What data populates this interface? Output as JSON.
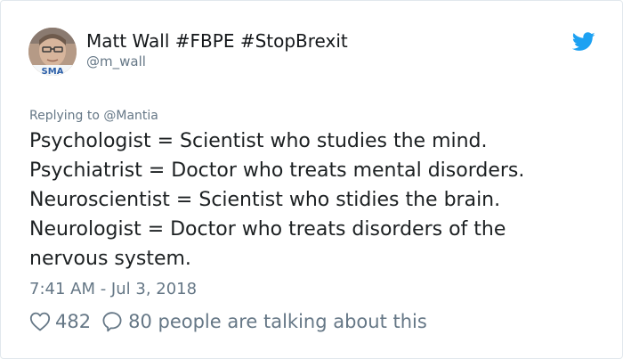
{
  "tweet": {
    "display_name": "Matt Wall #FBPE #StopBrexit",
    "handle": "@m_wall",
    "avatar_badge_text": "SMA",
    "replying_to": "Replying to @Mantia",
    "text_lines": [
      "Psychologist = Scientist who studies the mind.",
      "Psychiatrist = Doctor who treats mental disorders.",
      "Neuroscientist = Scientist who stidies the brain.",
      "Neurologist = Doctor who treats disorders of the",
      "nervous system."
    ],
    "timestamp": "7:41 AM - Jul 3, 2018",
    "likes": "482",
    "talking": "80 people are talking about this"
  },
  "colors": {
    "twitter_blue": "#1da1f2",
    "secondary_text": "#657786",
    "primary_text": "#14171a",
    "border": "#e1e8ed"
  },
  "icons": {
    "brand": "twitter-bird-icon",
    "like": "heart-icon",
    "reply": "comment-bubble-icon"
  }
}
